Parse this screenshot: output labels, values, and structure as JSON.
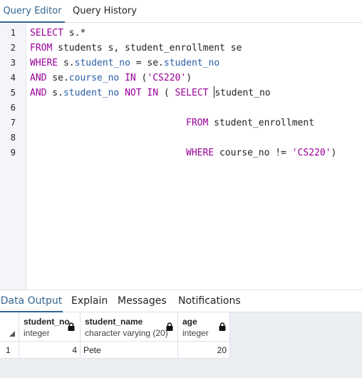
{
  "top_tabs": {
    "query_editor": "Query Editor",
    "query_history": "Query History"
  },
  "editor": {
    "line_numbers": [
      "1",
      "2",
      "3",
      "4",
      "5",
      "6",
      "7",
      "8",
      "9"
    ],
    "lines": [
      [
        "SELECT",
        " s.*"
      ],
      [
        "FROM",
        " students s, student_enrollment se"
      ],
      [
        "WHERE",
        " s.",
        "student_no",
        " = se.",
        "student_no"
      ],
      [
        "AND",
        " se.",
        "course_no",
        " ",
        "IN",
        " (",
        "'CS220'",
        ")"
      ],
      [
        "AND",
        " s.",
        "student_no",
        " ",
        "NOT IN",
        " ( ",
        "SELECT",
        " ",
        "student_no"
      ],
      [],
      [
        "FROM",
        " student_enrollment"
      ],
      [],
      [
        "WHERE",
        " course_no != ",
        "'CS220'",
        ")"
      ]
    ]
  },
  "bottom_tabs": {
    "data_output": "Data Output",
    "explain": "Explain",
    "messages": "Messages",
    "notifications": "Notifications"
  },
  "grid": {
    "columns": [
      {
        "name": "student_no",
        "type": "integer"
      },
      {
        "name": "student_name",
        "type": "character varying (20)"
      },
      {
        "name": "age",
        "type": "integer"
      }
    ],
    "rows": [
      {
        "row_number": "1",
        "cells": [
          "4",
          "Pete",
          "20"
        ]
      }
    ]
  },
  "colors": {
    "keyword": "#990099",
    "identifier": "#2a5ea8",
    "string": "#990099",
    "active_tab": "#326690",
    "gutter": "#f3f5f9",
    "grid_background": "#ebeef3"
  },
  "icons": {
    "column_lock": "lock-icon",
    "select_all": "triangle-corner-icon"
  }
}
